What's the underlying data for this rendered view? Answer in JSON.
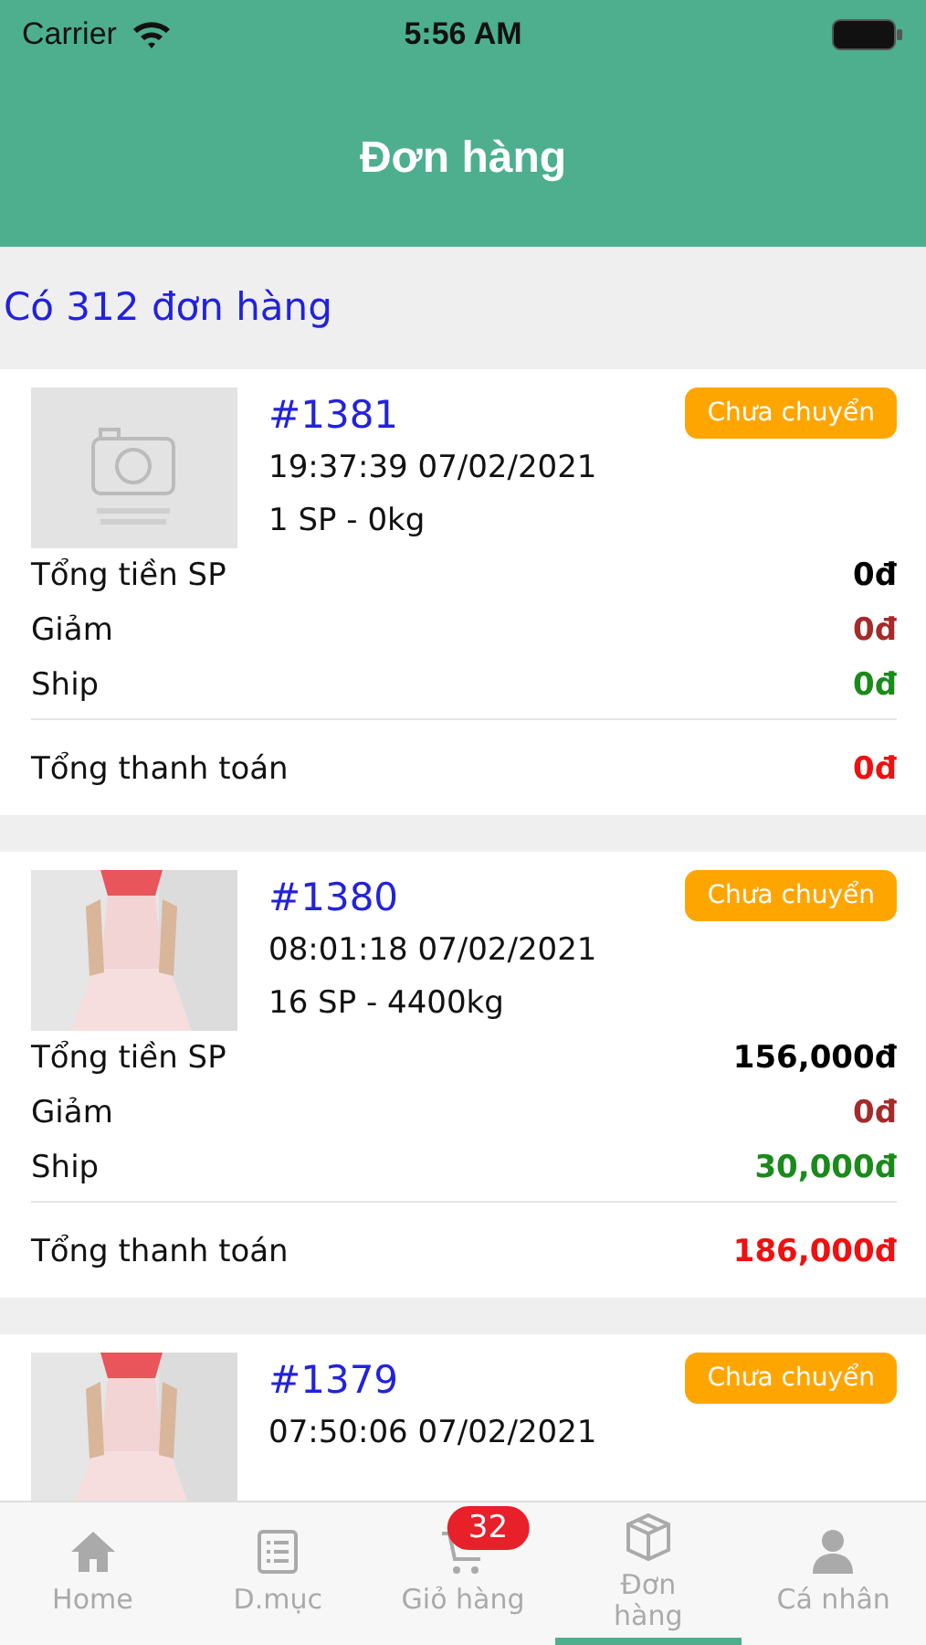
{
  "status_bar": {
    "carrier": "Carrier",
    "time": "5:56 AM"
  },
  "nav": {
    "title": "Đơn hàng"
  },
  "summary": "Có 312 đơn hàng",
  "orders": [
    {
      "id": "#1381",
      "time": "19:37:39 07/02/2021",
      "items": "1 SP - 0kg",
      "status": "Chưa chuyển",
      "kind": "placeholder",
      "lines": [
        {
          "label": "Tổng tiền SP",
          "value": "0đ",
          "kind": "subtotal"
        },
        {
          "label": "Giảm",
          "value": "0đ",
          "kind": "discount"
        },
        {
          "label": "Ship",
          "value": "0đ",
          "kind": "ship"
        },
        {
          "label": "Tổng thanh toán",
          "value": "0đ",
          "kind": "total"
        }
      ]
    },
    {
      "id": "#1380",
      "time": "08:01:18 07/02/2021",
      "items": "16 SP - 4400kg",
      "status": "Chưa chuyển",
      "lines": [
        {
          "label": "Tổng tiền SP",
          "value": "156,000đ",
          "kind": "subtotal"
        },
        {
          "label": "Giảm",
          "value": "0đ",
          "kind": "discount"
        },
        {
          "label": "Ship",
          "value": "30,000đ",
          "kind": "ship"
        },
        {
          "label": "Tổng thanh toán",
          "value": "186,000đ",
          "kind": "total"
        }
      ]
    },
    {
      "id": "#1379",
      "time": "07:50:06 07/02/2021",
      "status": "Chưa chuyển"
    }
  ],
  "tabs": [
    {
      "label": "Home",
      "kind": "home",
      "selected": false
    },
    {
      "label": "D.mục",
      "kind": "list",
      "selected": false
    },
    {
      "label": "Giỏ hàng",
      "kind": "cart",
      "selected": false,
      "badge": "32"
    },
    {
      "label": "Đơn hàng",
      "kind": "box",
      "selected": true
    },
    {
      "label": "Cá nhân",
      "kind": "person",
      "selected": false
    }
  ]
}
